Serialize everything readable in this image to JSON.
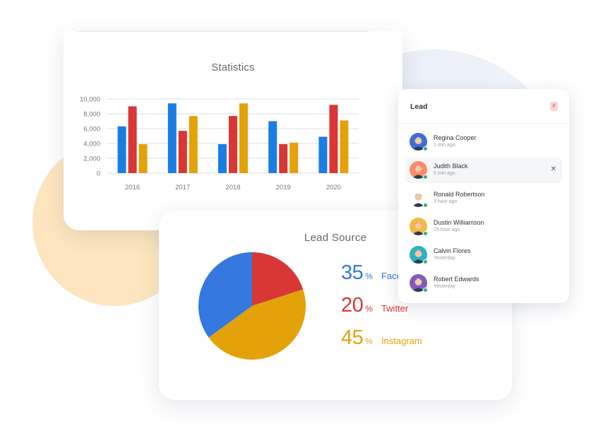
{
  "statistics": {
    "title": "Statistics"
  },
  "chart_data": {
    "type": "bar",
    "title": "Statistics",
    "categories": [
      "2016",
      "2017",
      "2018",
      "2019",
      "2020"
    ],
    "y_ticks": [
      "10,000",
      "8,000",
      "6,000",
      "4,000",
      "2,000",
      "0"
    ],
    "ylim": [
      0,
      10000
    ],
    "grid": true,
    "series": [
      {
        "color": "#1a7de3",
        "values": [
          6300,
          9400,
          3900,
          7000,
          4900
        ]
      },
      {
        "color": "#d93636",
        "values": [
          9000,
          5700,
          7700,
          3900,
          9200
        ]
      },
      {
        "color": "#e3a20a",
        "values": [
          3900,
          7700,
          9400,
          4100,
          7100
        ]
      }
    ]
  },
  "lead_source": {
    "title": "Lead Source",
    "pie": [
      {
        "label": "Twitter",
        "percent": 20,
        "color": "#d93636"
      },
      {
        "label": "Instagram",
        "percent": 45,
        "color": "#e3a20a"
      },
      {
        "label": "Facebook",
        "percent": 35,
        "color": "#3478e0"
      }
    ],
    "items": [
      {
        "value": "35",
        "symbol": "%",
        "label": "Facebook",
        "color": "#3478e0"
      },
      {
        "value": "20",
        "symbol": "%",
        "label": "Twitter",
        "color": "#d93636"
      },
      {
        "value": "45",
        "symbol": "%",
        "label": "Instagram",
        "color": "#e3a20a"
      }
    ]
  },
  "lead_panel": {
    "title": "Lead",
    "badge": "8",
    "leads": [
      {
        "name": "Regina Cooper",
        "time": "1 min ago",
        "avatar_color": "#3b6fd6",
        "active": false
      },
      {
        "name": "Judith Black",
        "time": "5 min ago",
        "avatar_color": "#ff8a6a",
        "active": true
      },
      {
        "name": "Ronald Robertson",
        "time": "3 hour ago",
        "avatar_color": "#ffffff",
        "active": false
      },
      {
        "name": "Dustin Williamson",
        "time": "15 hour ago",
        "avatar_color": "#f4b940",
        "active": false
      },
      {
        "name": "Calvin Flores",
        "time": "Yesterday",
        "avatar_color": "#2ab1c4",
        "active": false
      },
      {
        "name": "Robert Edwards",
        "time": "Yesterday",
        "avatar_color": "#7d5cc0",
        "active": false
      }
    ],
    "close_icon": "close-icon"
  }
}
